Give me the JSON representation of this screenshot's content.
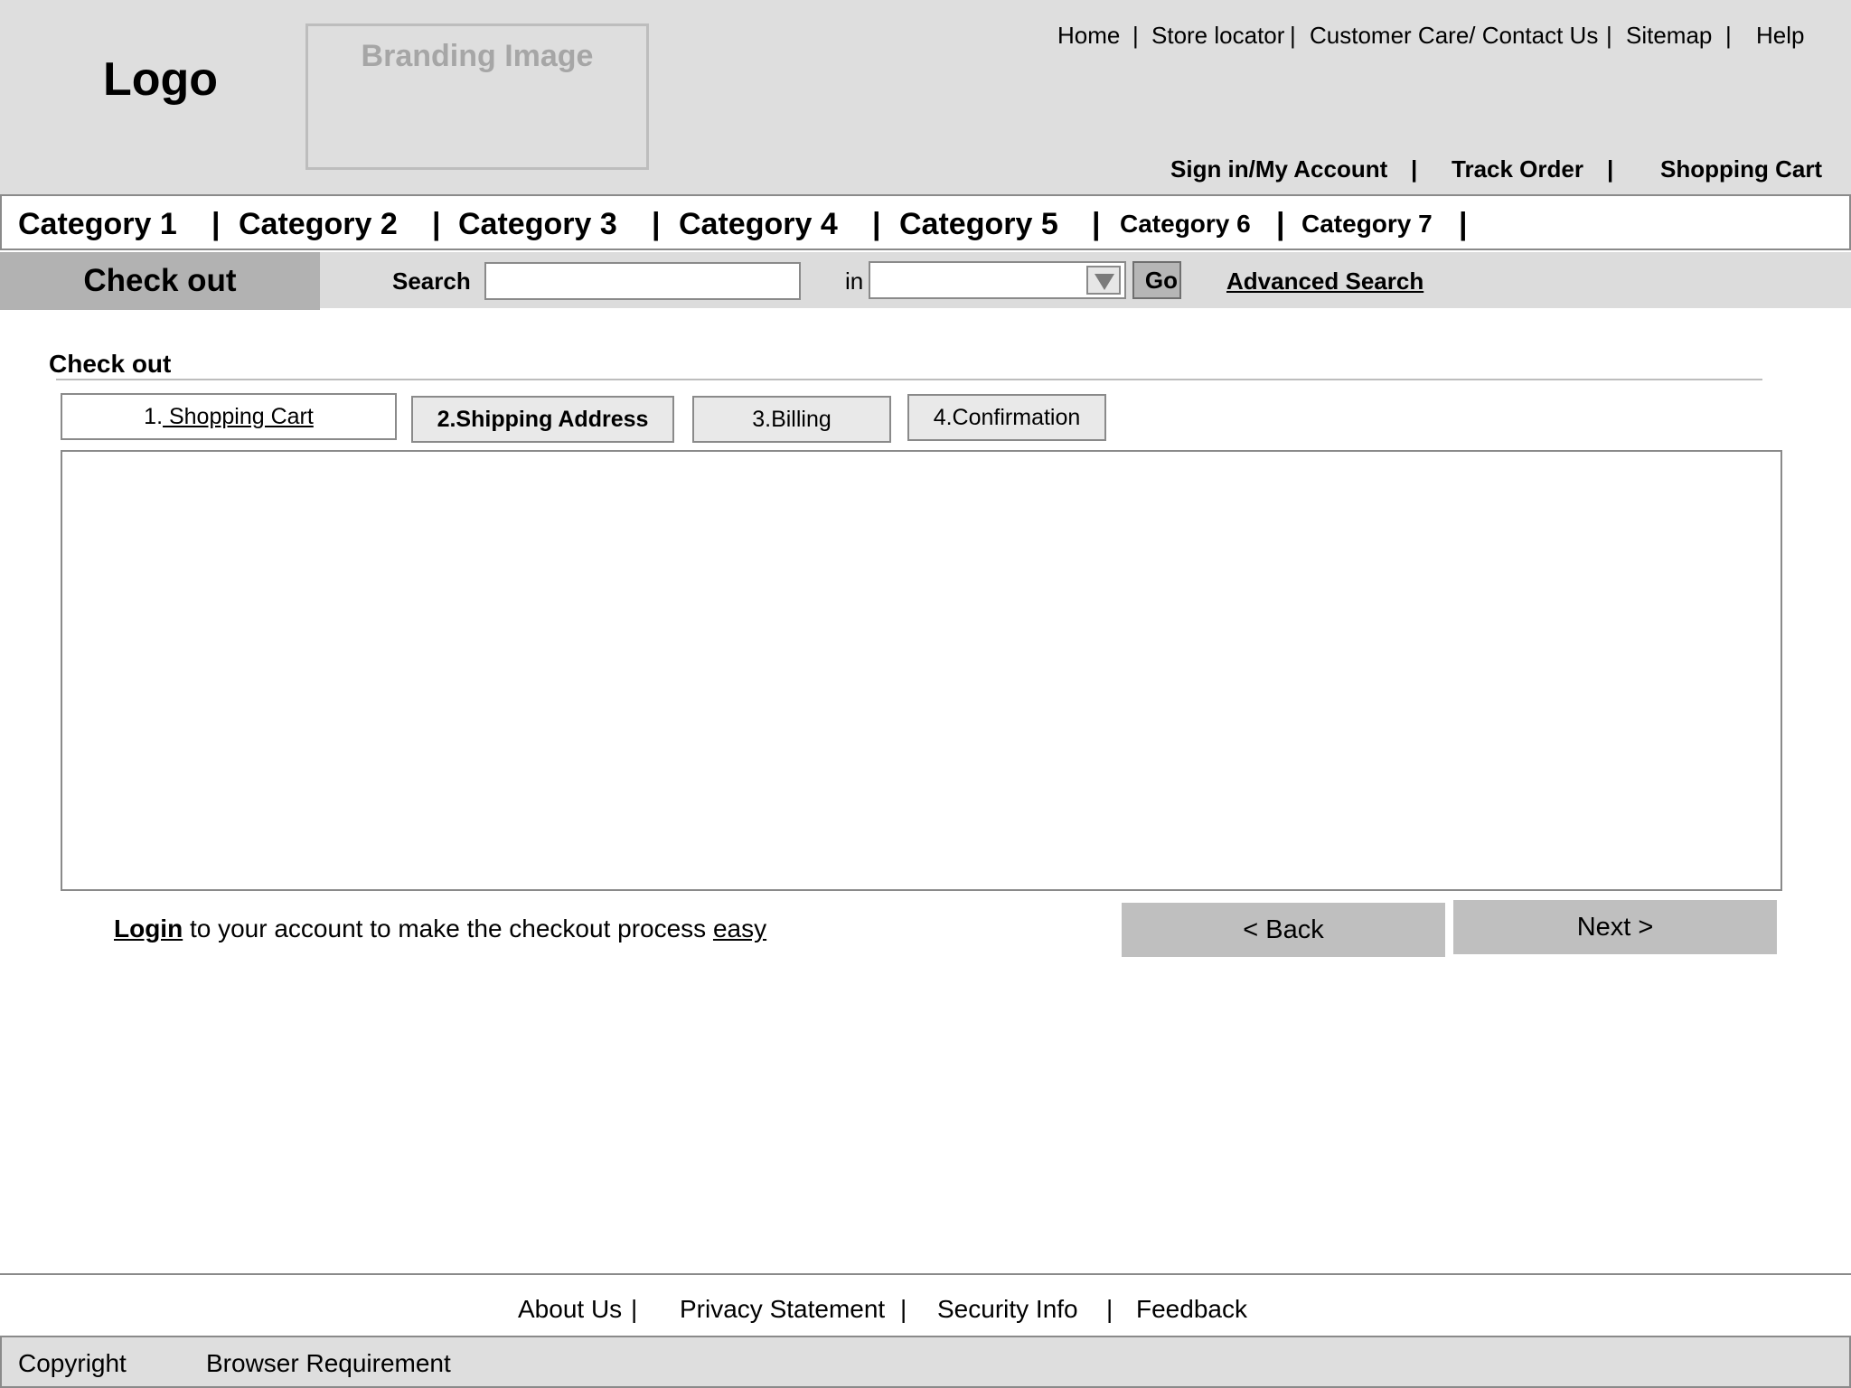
{
  "header": {
    "logo": "Logo",
    "branding_image": "Branding Image",
    "top_links": [
      "Home",
      "Store locator",
      "Customer Care/ Contact Us",
      "Sitemap",
      "Help"
    ],
    "separator": "|",
    "account_links": [
      "Sign in/My Account",
      "Track Order",
      "Shopping Cart"
    ]
  },
  "categories": [
    "Category 1",
    "Category 2",
    "Category 3",
    "Category 4",
    "Category 5",
    "Category 6",
    "Category 7"
  ],
  "search_bar": {
    "section_tab": "Check out",
    "search_label": "Search",
    "search_value": "",
    "in_label": "in",
    "category_value": "",
    "go_label": "Go",
    "advanced_search": "Advanced Search"
  },
  "checkout": {
    "title": "Check out",
    "steps": [
      {
        "number": "1.",
        "label": " Shopping Cart"
      },
      {
        "label": "2.Shipping Address"
      },
      {
        "label": "3.Billing"
      },
      {
        "label": "4.Confirmation"
      }
    ],
    "active_step": "2.Shipping Address",
    "login_link": "Login",
    "login_text": " to your account to make the checkout process ",
    "easy_link": "easy",
    "back_label": "< Back",
    "next_label": "Next >"
  },
  "footer": {
    "links": [
      "About Us",
      "Privacy Statement",
      "Security Info",
      "Feedback"
    ],
    "separator": "|",
    "copyright": "Copyright",
    "browser_requirement": "Browser Requirement"
  },
  "colors": {
    "header_bg": "#dedede",
    "tab_active_bg": "#b2b2b2",
    "button_bg": "#bfbfbf",
    "border": "#8a8a8a"
  }
}
